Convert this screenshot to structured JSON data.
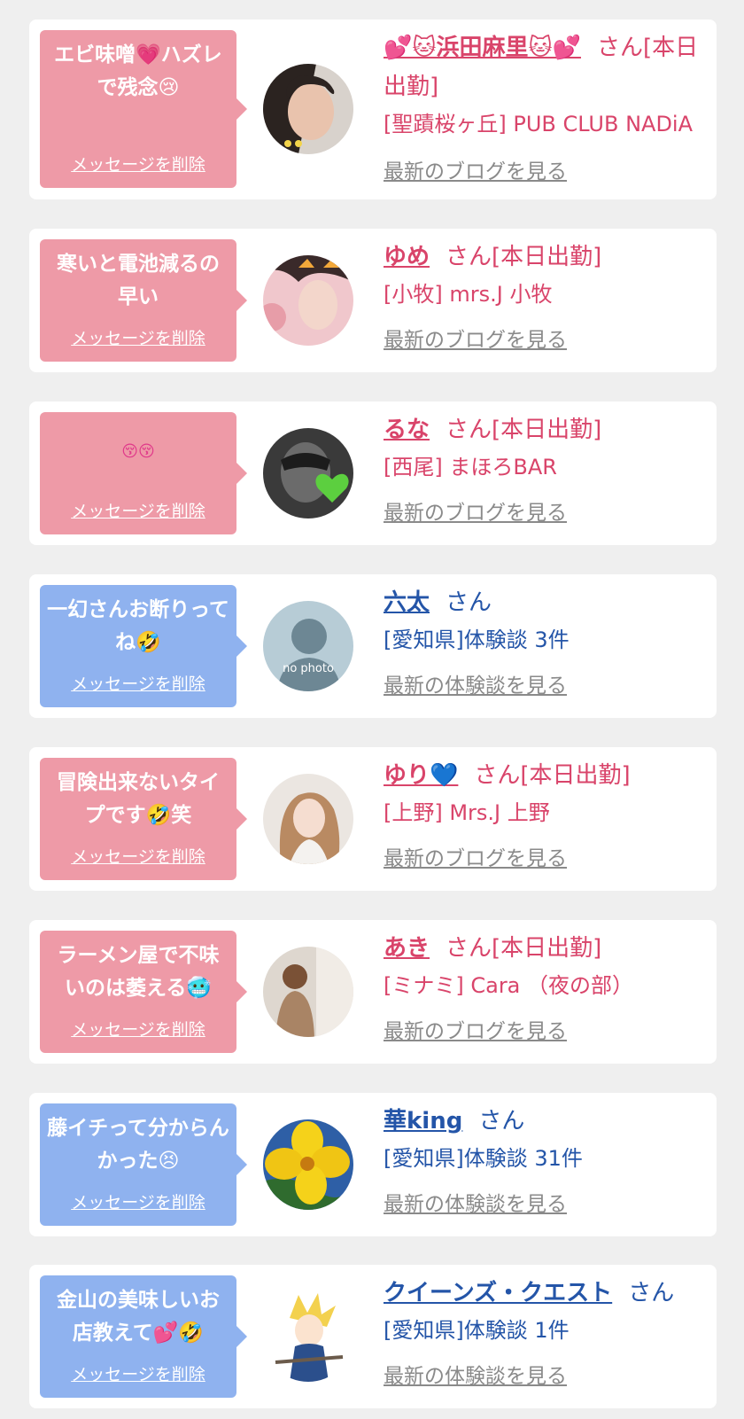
{
  "delete_label": "メッセージを削除",
  "cards": [
    {
      "message": "エビ味噌💗ハズレで残念😢",
      "name": "💕🐱浜田麻里🐱💕",
      "suffix": "さん[本日出勤]",
      "shop": "[聖蹟桜ヶ丘] PUB CLUB NADiA",
      "link": "最新のブログを見る",
      "type": "cast"
    },
    {
      "message": "寒いと電池減るの早い",
      "name": "ゆめ",
      "suffix": "さん[本日出勤]",
      "shop": "[小牧] mrs.J 小牧",
      "link": "最新のブログを見る",
      "type": "cast"
    },
    {
      "message": "😚😚",
      "name": "るな",
      "suffix": "さん[本日出勤]",
      "shop": "[西尾] まほろBAR",
      "link": "最新のブログを見る",
      "type": "cast"
    },
    {
      "message": "一幻さんお断りってね🤣",
      "name": "六太",
      "suffix": "さん",
      "shop": "[愛知県]体験談 3件",
      "link": "最新の体験談を見る",
      "type": "user",
      "avatar_text": "no photo"
    },
    {
      "message": "冒険出来ないタイプです🤣笑",
      "name": "ゆり💙",
      "suffix": "さん[本日出勤]",
      "shop": "[上野] Mrs.J 上野",
      "link": "最新のブログを見る",
      "type": "cast"
    },
    {
      "message": "ラーメン屋で不味いのは萎える🥶",
      "name": "あき",
      "suffix": "さん[本日出勤]",
      "shop": "[ミナミ] Cara （夜の部）",
      "link": "最新のブログを見る",
      "type": "cast"
    },
    {
      "message": "藤イチって分からんかった😣",
      "name": "華king",
      "suffix": "さん",
      "shop": "[愛知県]体験談 31件",
      "link": "最新の体験談を見る",
      "type": "user"
    },
    {
      "message": "金山の美味しいお店教えて💕🤣",
      "name": "クイーンズ・クエスト",
      "suffix": "さん",
      "shop": "[愛知県]体験談 1件",
      "link": "最新の体験談を見る",
      "type": "user"
    }
  ],
  "colors": {
    "pink_bubble": "#ee9aa7",
    "blue_bubble": "#8fb2ef",
    "cast_text": "#d9446a",
    "user_text": "#2455a8",
    "link_gray": "#8a8a8a",
    "background": "#efefef"
  }
}
